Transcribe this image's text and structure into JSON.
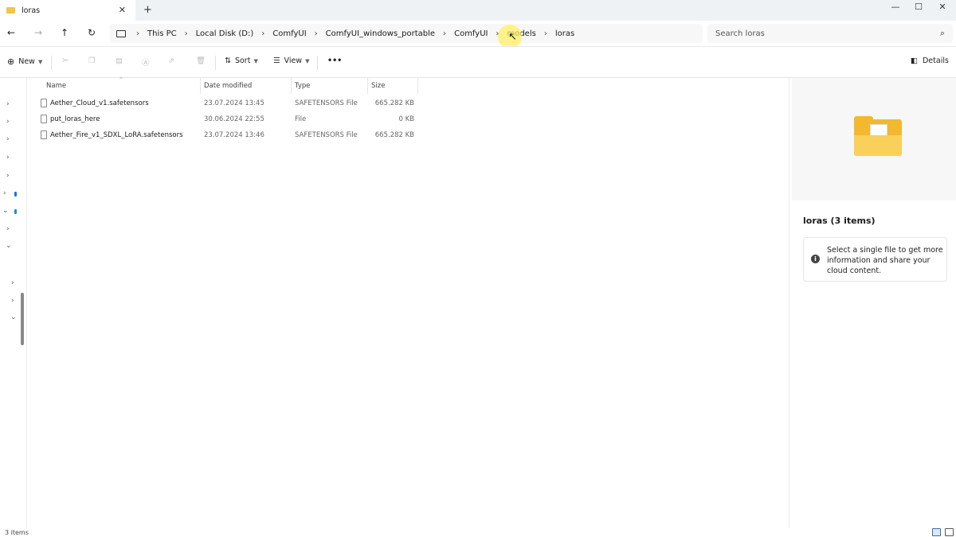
{
  "window": {
    "tab_title": "loras",
    "tab_close": "✕",
    "new_tab": "+",
    "minimize": "—",
    "maximize": "☐",
    "close": "✕"
  },
  "nav": {
    "back": "←",
    "forward": "→",
    "up": "↑",
    "refresh": "↻"
  },
  "breadcrumbs": [
    "This PC",
    "Local Disk (D:)",
    "ComfyUI",
    "ComfyUI_windows_portable",
    "ComfyUI",
    "models",
    "loras"
  ],
  "search": {
    "placeholder": "Search loras",
    "icon": "search-icon"
  },
  "toolbar": {
    "new_label": "New",
    "sort_label": "Sort",
    "view_label": "View",
    "more_label": "•••",
    "details_label": "Details"
  },
  "columns": {
    "name": "Name",
    "date": "Date modified",
    "type": "Type",
    "size": "Size"
  },
  "files": [
    {
      "name": "Aether_Cloud_v1.safetensors",
      "date": "23.07.2024 13:45",
      "type": "SAFETENSORS File",
      "size": "665.282 KB"
    },
    {
      "name": "put_loras_here",
      "date": "30.06.2024 22:55",
      "type": "File",
      "size": "0 KB"
    },
    {
      "name": "Aether_Fire_v1_SDXL_LoRA.safetensors",
      "date": "23.07.2024 13:46",
      "type": "SAFETENSORS File",
      "size": "665.282 KB"
    }
  ],
  "details_pane": {
    "title": "loras (3 items)",
    "info_icon": "i",
    "info_text": "Select a single file to get more information and share your cloud content."
  },
  "status": {
    "item_count": "3 items"
  },
  "colors": {
    "folder": "#f2b92f",
    "accent": "#3a6ea5"
  }
}
